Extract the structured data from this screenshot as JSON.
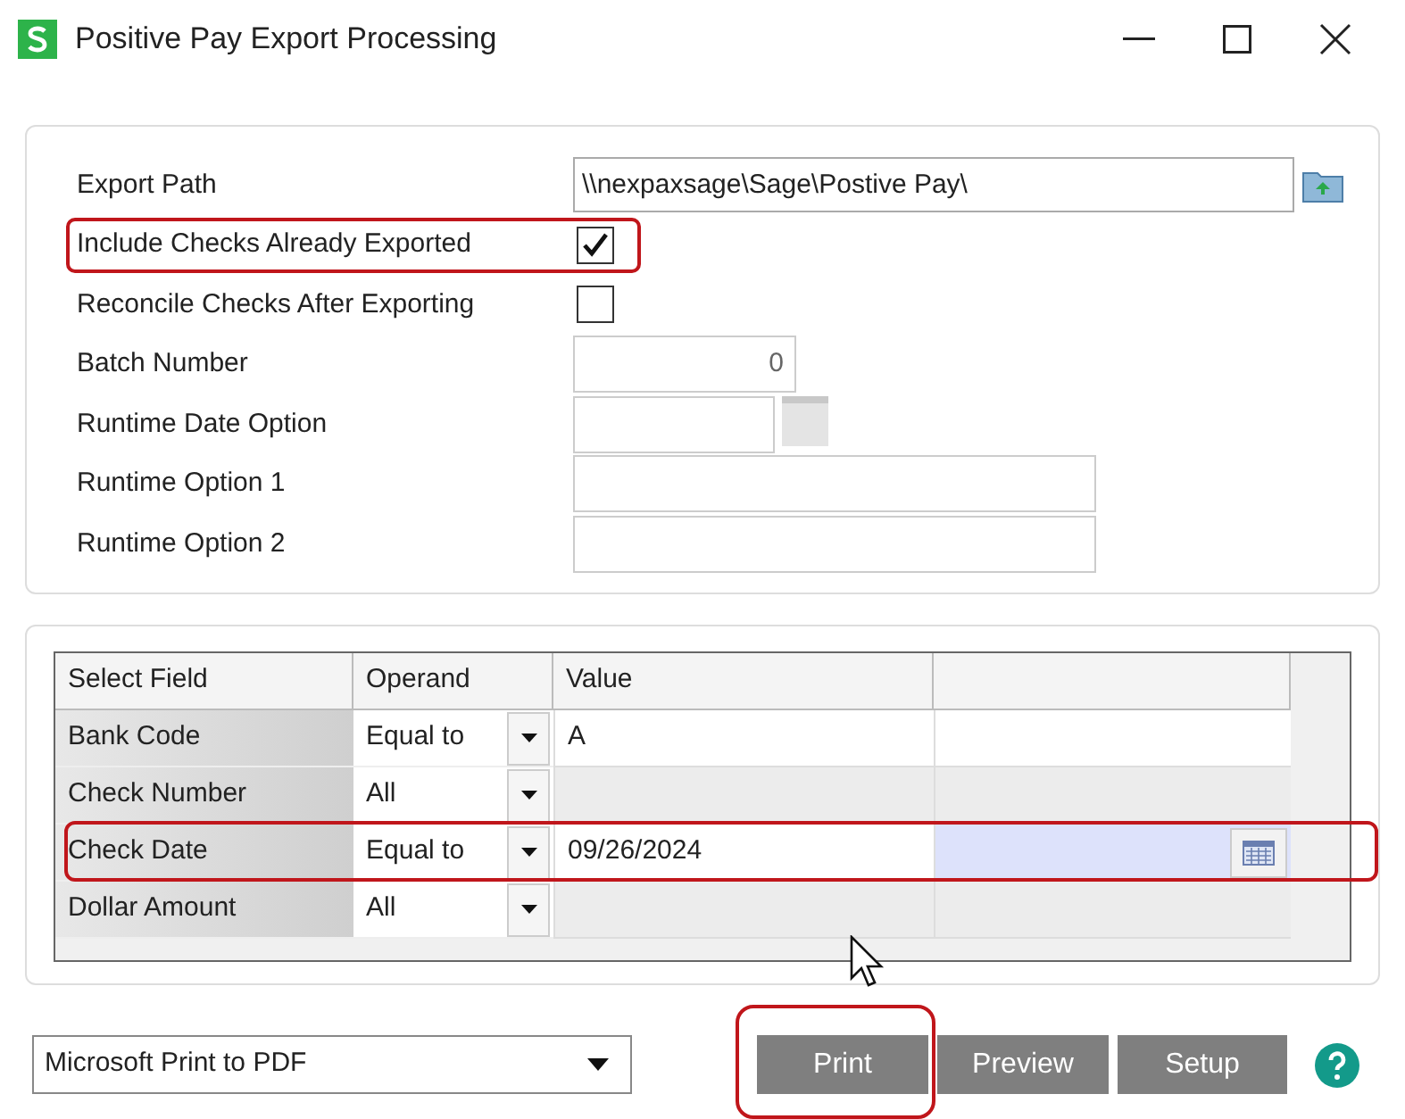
{
  "window": {
    "title": "Positive Pay Export Processing"
  },
  "options": [
    {
      "kind": "path",
      "label": "Export Path",
      "value": "\\\\nexpaxsage\\Sage\\Postive Pay\\",
      "highlighted": false
    },
    {
      "kind": "checkbox",
      "label": "Include Checks Already Exported",
      "checked": true,
      "highlighted": true
    },
    {
      "kind": "checkbox",
      "label": "Reconcile Checks After Exporting",
      "checked": false,
      "highlighted": false
    },
    {
      "kind": "number",
      "label": "Batch Number",
      "value": "0",
      "highlighted": false
    },
    {
      "kind": "date",
      "label": "Runtime Date Option",
      "highlighted": false
    },
    {
      "kind": "text",
      "label": "Runtime Option 1",
      "highlighted": false
    },
    {
      "kind": "text",
      "label": "Runtime Option 2",
      "highlighted": false
    }
  ],
  "selection_grid": {
    "columns": [
      "Select Field",
      "Operand",
      "Value"
    ],
    "rows": [
      {
        "field": "Bank Code",
        "operand": "Equal to",
        "value": "A",
        "kind": "text",
        "enabled": true,
        "selected": false,
        "highlighted": false
      },
      {
        "field": "Check Number",
        "operand": "All",
        "kind": "number",
        "enabled": false,
        "selected": false,
        "highlighted": false
      },
      {
        "field": "Check Date",
        "operand": "Equal to",
        "value": "09/26/2024",
        "kind": "date",
        "enabled": true,
        "selected": true,
        "highlighted": true
      },
      {
        "field": "Dollar Amount",
        "operand": "All",
        "kind": "number",
        "enabled": false,
        "selected": false,
        "highlighted": false
      }
    ]
  },
  "printer": {
    "value": "Microsoft Print to PDF"
  },
  "buttons": [
    {
      "label": "Print",
      "highlighted": true
    },
    {
      "label": "Preview",
      "highlighted": false
    },
    {
      "label": "Setup",
      "highlighted": false
    }
  ]
}
